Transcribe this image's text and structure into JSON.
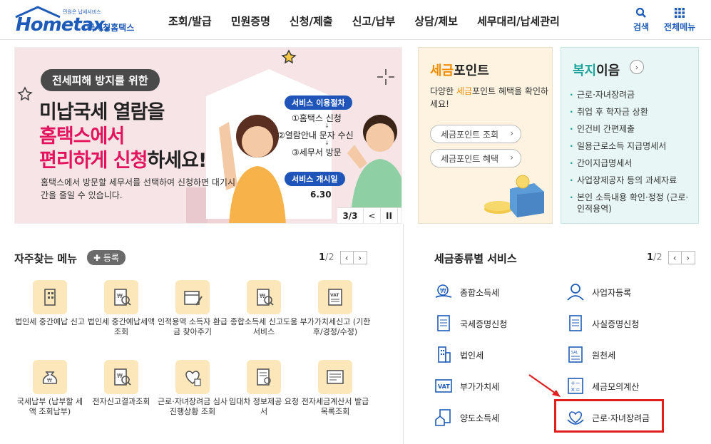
{
  "header": {
    "logo_sub": "민원은 납세서비스",
    "logo_main": "Hometax.",
    "logo_kr": "국세청홈택스",
    "nav": [
      "조회/발급",
      "민원증명",
      "신청/제출",
      "신고/납부",
      "상담/제보",
      "세무대리/납세관리"
    ],
    "search_label": "검색",
    "menu_label": "전체메뉴"
  },
  "banner": {
    "pill": "전세피해 방지를 위한",
    "line1": "미납국세 열람을",
    "line2": "홈택스에서",
    "line3_pink": "편리하게 신청",
    "line3_rest": "하세요!",
    "desc": "홈택스에서 방문할 세무서를 선택하여 신청하면 대기시간을 줄일 수 있습니다.",
    "chip1": "서비스 이용절차",
    "step1": "①홈택스 신청",
    "step2": "②열람안내 문자 수신",
    "step3": "③세무서 방문",
    "chip2": "서비스 개시일",
    "date": "6.30",
    "counter": "3/3",
    "prev": "<",
    "pause": "II",
    "next": ">"
  },
  "point": {
    "title_accent": "세금",
    "title_rest": "포인트",
    "desc_pre": "다양한 ",
    "desc_accent": "세금",
    "desc_post": "포인트 혜택을 확인하세요!",
    "btn1": "세금포인트 조회",
    "btn2": "세금포인트 혜택",
    "accent_color": "#f08c00"
  },
  "welfare": {
    "title_accent": "복지",
    "title_rest": "이음",
    "items": [
      "근로·자녀장려금",
      "취업 후 학자금 상환",
      "인건비 간편제출",
      "일용근로소득 지급명세서",
      "간이지급명세서",
      "사업장제공자 등의 과세자료"
    ],
    "last_item": "본인 소득내용 확인·정정 (근로·인적용역)",
    "accent_color": "#1aa39a"
  },
  "favorites": {
    "title": "자주찾는 메뉴",
    "register": "등록",
    "page_cur": "1",
    "page_tot": "/2",
    "items": [
      {
        "label": "법인세 중간예납 신고",
        "icon": "building-icon"
      },
      {
        "label": "법인세 중간예납세액 조회",
        "icon": "won-search-icon"
      },
      {
        "label": "인적용역 소득자 환급금 찾아주기",
        "icon": "calendar-pen-icon"
      },
      {
        "label": "종합소득세 신고도움 서비스",
        "icon": "won-search-icon"
      },
      {
        "label": "부가가치세신고 (기한후/경정/수정)",
        "icon": "vat-doc-icon"
      },
      {
        "label": "국세납부 (납부할 세액 조회납부)",
        "icon": "money-bag-icon"
      },
      {
        "label": "전자신고결과조회",
        "icon": "won-search-icon"
      },
      {
        "label": "근로·자녀장려금 심사진행상황 조회",
        "icon": "heart-hourglass-icon"
      },
      {
        "label": "임대차 정보제공 요청서",
        "icon": "doc-search-icon"
      },
      {
        "label": "전자세금계산서 발급목록조회",
        "icon": "invoice-icon"
      }
    ]
  },
  "taxservices": {
    "title": "세금종류별 서비스",
    "page_cur": "1",
    "page_tot": "/2",
    "left": [
      {
        "label": "종합소득세",
        "icon": "won-hand-icon"
      },
      {
        "label": "국세증명신청",
        "icon": "document-icon"
      },
      {
        "label": "법인세",
        "icon": "building-icon"
      },
      {
        "label": "부가가치세",
        "icon": "vat-icon"
      },
      {
        "label": "양도소득세",
        "icon": "house-doc-icon"
      }
    ],
    "right": [
      {
        "label": "사업자등록",
        "icon": "person-icon"
      },
      {
        "label": "사실증명신청",
        "icon": "document-icon"
      },
      {
        "label": "원천세",
        "icon": "receipt-icon"
      },
      {
        "label": "세금모의계산",
        "icon": "calculator-icon"
      },
      {
        "label": "근로·자녀장려금",
        "icon": "heart-hand-icon"
      }
    ]
  }
}
